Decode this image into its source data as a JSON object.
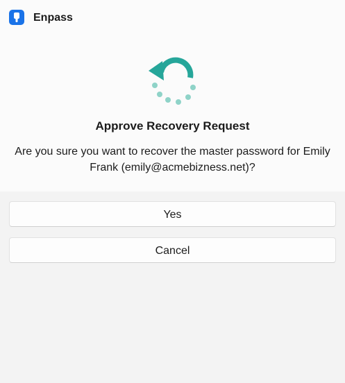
{
  "window": {
    "app_title": "Enpass",
    "app_icon": "enpass-keyhole-icon"
  },
  "dialog": {
    "icon": "recovery-arrow-icon",
    "title": "Approve Recovery Request",
    "message": "Are you sure you want to recover the master password for Emily Frank (emily@acmebizness.net)?"
  },
  "buttons": {
    "yes_label": "Yes",
    "cancel_label": "Cancel"
  },
  "colors": {
    "brand_blue": "#1a73e8",
    "accent_teal": "#26a69a",
    "dots_teal": "#8fd3c8",
    "dialog_bg": "#fbfbfb",
    "button_area_bg": "#f3f3f3"
  }
}
